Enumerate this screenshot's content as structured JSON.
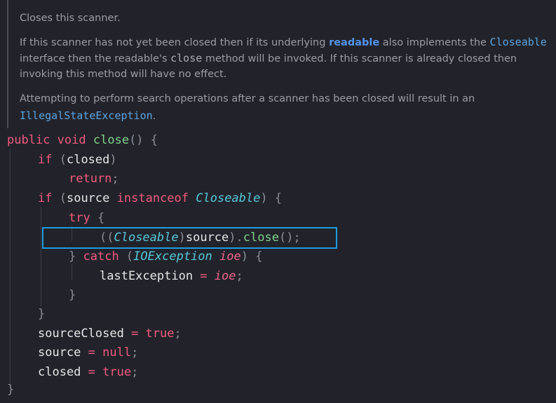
{
  "doc": {
    "line1": "Closes this scanner.",
    "para2": {
      "a": "If this scanner has not yet been closed then if its underlying ",
      "readable_link": "readable",
      "b": " also implements the ",
      "closeable_link": "Closeable",
      "c": "interface then the readable's ",
      "close_code": "close",
      "d": " method will be invoked. If this scanner is already closed then",
      "e": "invoking this method will have no effect."
    },
    "para3": {
      "a": "Attempting to perform search operations after a scanner has been closed will result in an",
      "exception_link": "IllegalStateException",
      "b": "."
    }
  },
  "code": {
    "line1": {
      "kw1": "public",
      "kw2": "void",
      "fn": "close",
      "punc": "() {"
    },
    "line2": {
      "kw": "if",
      "open": " (",
      "var": "closed",
      "close": ")"
    },
    "line3": {
      "kw": "return",
      "semi": ";"
    },
    "line4": {
      "kw": "if",
      "open": " (",
      "var": "source",
      "kw2": "instanceof",
      "type": "Closeable",
      "close": ") {"
    },
    "line5": {
      "kw": "try",
      "brace": " {"
    },
    "line6": {
      "open": "((",
      "type": "Closeable",
      "close1": ")",
      "var": "source",
      "close2": ").",
      "fn": "close",
      "end": "();"
    },
    "line7": {
      "brace": "}",
      "kw": "catch",
      "open": " (",
      "type": "IOException",
      "var": "ioe",
      "close": ") {"
    },
    "line8": {
      "var": "lastException",
      "eq": " = ",
      "val": "ioe",
      "semi": ";"
    },
    "line9": {
      "brace": "}"
    },
    "line10": {
      "brace": "}"
    },
    "line11": {
      "var": "sourceClosed",
      "eq": " = ",
      "val": "true",
      "semi": ";"
    },
    "line12": {
      "var": "source",
      "eq": " = ",
      "val": "null",
      "semi": ";"
    },
    "line13": {
      "var": "closed",
      "eq": " = ",
      "val": "true",
      "semi": ";"
    },
    "line14": {
      "brace": "}"
    }
  },
  "colors": {
    "background": "#22232a",
    "keyword": "#f05a7e",
    "function": "#7fd48a",
    "type": "#56c8dc",
    "link": "#5394ec",
    "highlight_border": "#1e9bde"
  }
}
